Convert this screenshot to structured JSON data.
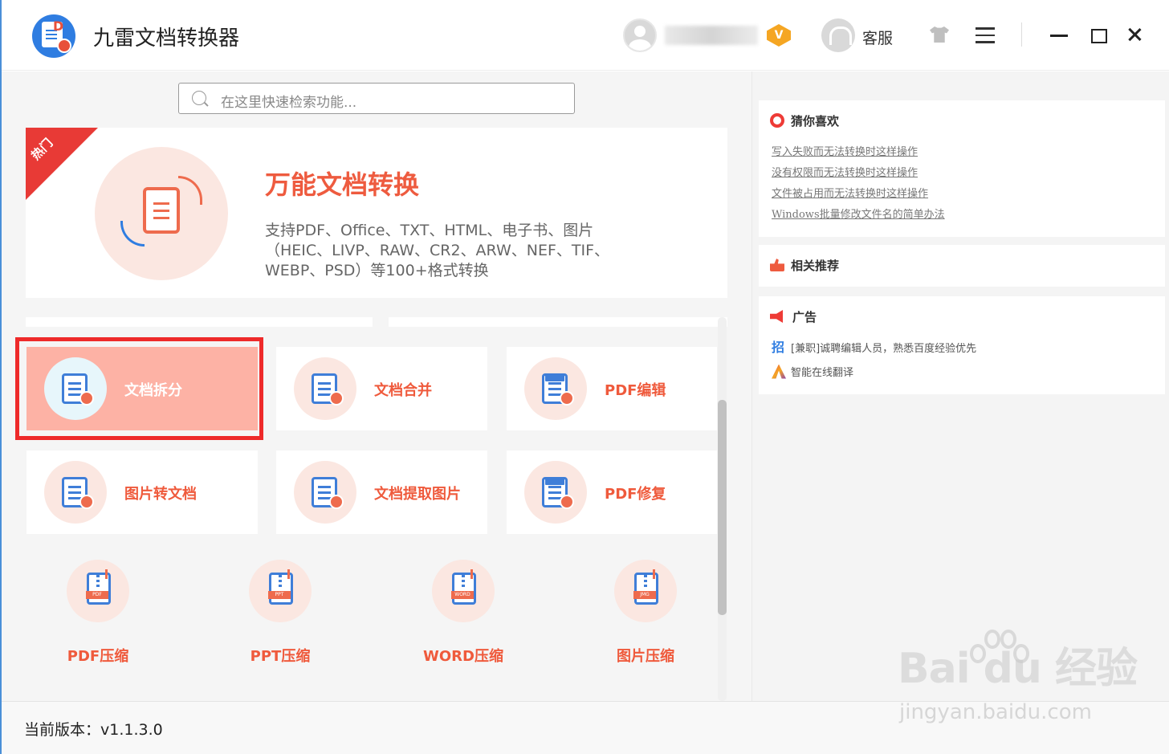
{
  "app": {
    "title": "九雷文档转换器",
    "service_label": "客服",
    "vip_badge": "V"
  },
  "search": {
    "placeholder": "在这里快速检索功能..."
  },
  "hero": {
    "ribbon": "热门",
    "title": "万能文档转换",
    "description": "支持PDF、Office、TXT、HTML、电子书、图片（HEIC、LIVP、RAW、CR2、ARW、NEF、TIF、WEBP、PSD）等100+格式转换"
  },
  "tools": [
    {
      "label": "文档拆分",
      "icon": "document-split-icon"
    },
    {
      "label": "文档合并",
      "icon": "document-merge-icon"
    },
    {
      "label": "PDF编辑",
      "icon": "pdf-edit-icon"
    },
    {
      "label": "图片转文档",
      "icon": "image-to-document-icon"
    },
    {
      "label": "文档提取图片",
      "icon": "extract-image-icon"
    },
    {
      "label": "PDF修复",
      "icon": "pdf-repair-icon"
    }
  ],
  "compress": [
    {
      "label": "PDF压缩",
      "tag": "PDF"
    },
    {
      "label": "PPT压缩",
      "tag": "PPT"
    },
    {
      "label": "WORD压缩",
      "tag": "WORD"
    },
    {
      "label": "图片压缩",
      "tag": "JMG"
    }
  ],
  "sidebar": {
    "guess": {
      "title": "猜你喜欢",
      "links": [
        "写入失败而无法转换时这样操作",
        "没有权限而无法转换时这样操作",
        "文件被占用而无法转换时这样操作",
        "Windows批量修改文件名的简单办法"
      ]
    },
    "related": {
      "title": "相关推荐"
    },
    "ads": {
      "title": "广告",
      "items": [
        {
          "icon_text": "招",
          "text": "[兼职]诚聘编辑人员，熟悉百度经验优先"
        },
        {
          "icon_text": "",
          "text": "智能在线翻译"
        }
      ]
    }
  },
  "footer": {
    "version": "当前版本：v1.1.3.0"
  },
  "watermark": {
    "brand": "Bai du 经验",
    "url": "jingyan.baidu.com"
  },
  "colors": {
    "accent": "#ef5a3c",
    "active_card": "#fdb2a5",
    "highlight": "#ee2a2a"
  }
}
